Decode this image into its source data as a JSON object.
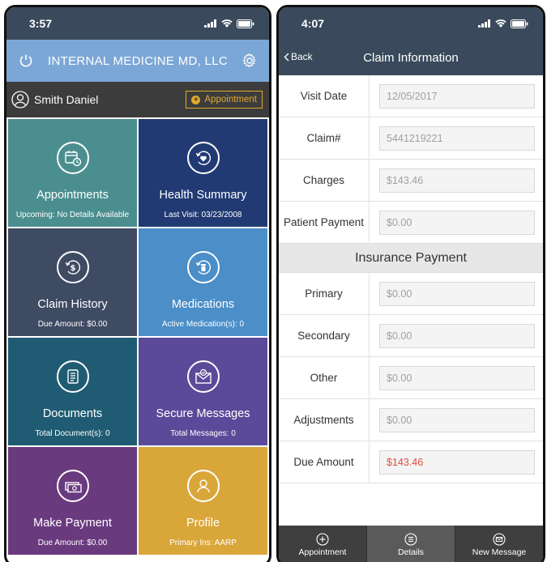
{
  "left": {
    "status": {
      "time": "3:57"
    },
    "header": {
      "title": "INTERNAL MEDICINE MD, LLC"
    },
    "user": {
      "name": "Smith Daniel",
      "appointment_label": "Appointment"
    },
    "tiles": [
      {
        "name": "Appointments",
        "sub": "Upcoming: No Details Available",
        "color": "#4b8e8f",
        "icon": "calendar-clock-icon"
      },
      {
        "name": "Health Summary",
        "sub": "Last Visit: 03/23/2008",
        "color": "#213a73",
        "icon": "heart-refresh-icon"
      },
      {
        "name": "Claim History",
        "sub": "Due Amount: $0.00",
        "color": "#3f4a63",
        "icon": "dollar-history-icon"
      },
      {
        "name": "Medications",
        "sub": "Active Medication(s): 0",
        "color": "#4b8ec8",
        "icon": "pill-bottle-icon"
      },
      {
        "name": "Documents",
        "sub": "Total Document(s): 0",
        "color": "#1f5c73",
        "icon": "document-icon"
      },
      {
        "name": "Secure Messages",
        "sub": "Total Messages: 0",
        "color": "#5b4a9a",
        "icon": "envelope-icon"
      },
      {
        "name": "Make Payment",
        "sub": "Due Amount: $0.00",
        "color": "#6a3a7f",
        "icon": "cash-icon"
      },
      {
        "name": "Profile",
        "sub": "Primary Ins: AARP",
        "color": "#d9a63a",
        "icon": "person-icon"
      }
    ]
  },
  "right": {
    "status": {
      "time": "4:07"
    },
    "nav": {
      "back_label": "Back",
      "title": "Claim Information"
    },
    "rows": [
      {
        "label": "Visit Date",
        "value": "12/05/2017"
      },
      {
        "label": "Claim#",
        "value": "5441219221"
      },
      {
        "label": "Charges",
        "value": "$143.46"
      },
      {
        "label": "Patient Payment",
        "value": "$0.00"
      }
    ],
    "insurance_header": "Insurance Payment",
    "insurance_rows": [
      {
        "label": "Primary",
        "value": "$0.00"
      },
      {
        "label": "Secondary",
        "value": "$0.00"
      },
      {
        "label": "Other",
        "value": "$0.00"
      },
      {
        "label": "Adjustments",
        "value": "$0.00"
      }
    ],
    "due": {
      "label": "Due Amount",
      "value": "$143.46",
      "color": "#e04a3a"
    },
    "tabs": [
      {
        "label": "Appointment",
        "icon": "plus-circle-icon"
      },
      {
        "label": "Details",
        "icon": "list-circle-icon"
      },
      {
        "label": "New Message",
        "icon": "envelope-circle-icon"
      }
    ]
  }
}
